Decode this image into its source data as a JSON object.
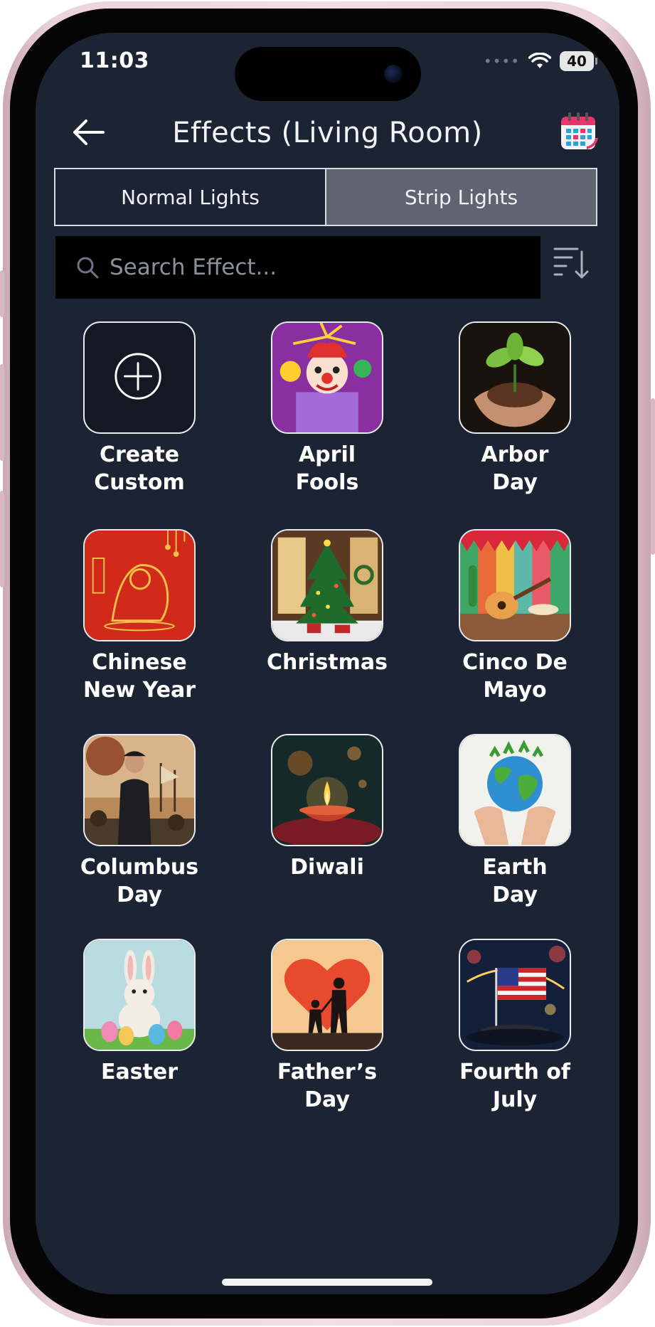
{
  "status_bar": {
    "time": "11:03",
    "battery": "40"
  },
  "header": {
    "title": "Effects (Living Room)"
  },
  "tabs": [
    {
      "label": "Normal Lights",
      "active": false
    },
    {
      "label": "Strip Lights",
      "active": true
    }
  ],
  "search": {
    "placeholder": "Search Effect...",
    "value": ""
  },
  "effects": [
    {
      "label": "Create Custom",
      "icon": "plus-circle-icon"
    },
    {
      "label": "April\nFools",
      "icon": "jester-icon"
    },
    {
      "label": "Arbor\nDay",
      "icon": "plant-in-hands-icon"
    },
    {
      "label": "Chinese\nNew Year",
      "icon": "lion-dance-icon"
    },
    {
      "label": "Christmas",
      "icon": "christmas-tree-icon"
    },
    {
      "label": "Cinco De\nMayo",
      "icon": "guitar-sombrero-icon"
    },
    {
      "label": "Columbus\nDay",
      "icon": "explorer-icon"
    },
    {
      "label": "Diwali",
      "icon": "diya-lamp-icon"
    },
    {
      "label": "Earth\nDay",
      "icon": "earth-globe-icon"
    },
    {
      "label": "Easter",
      "icon": "bunny-eggs-icon"
    },
    {
      "label": "Father’s\nDay",
      "icon": "father-child-heart-icon"
    },
    {
      "label": "Fourth of\nJuly",
      "icon": "american-flag-icon"
    }
  ],
  "colors": {
    "background": "#1c2433",
    "active_tab": "#5e6470",
    "search_bg": "#000000"
  }
}
